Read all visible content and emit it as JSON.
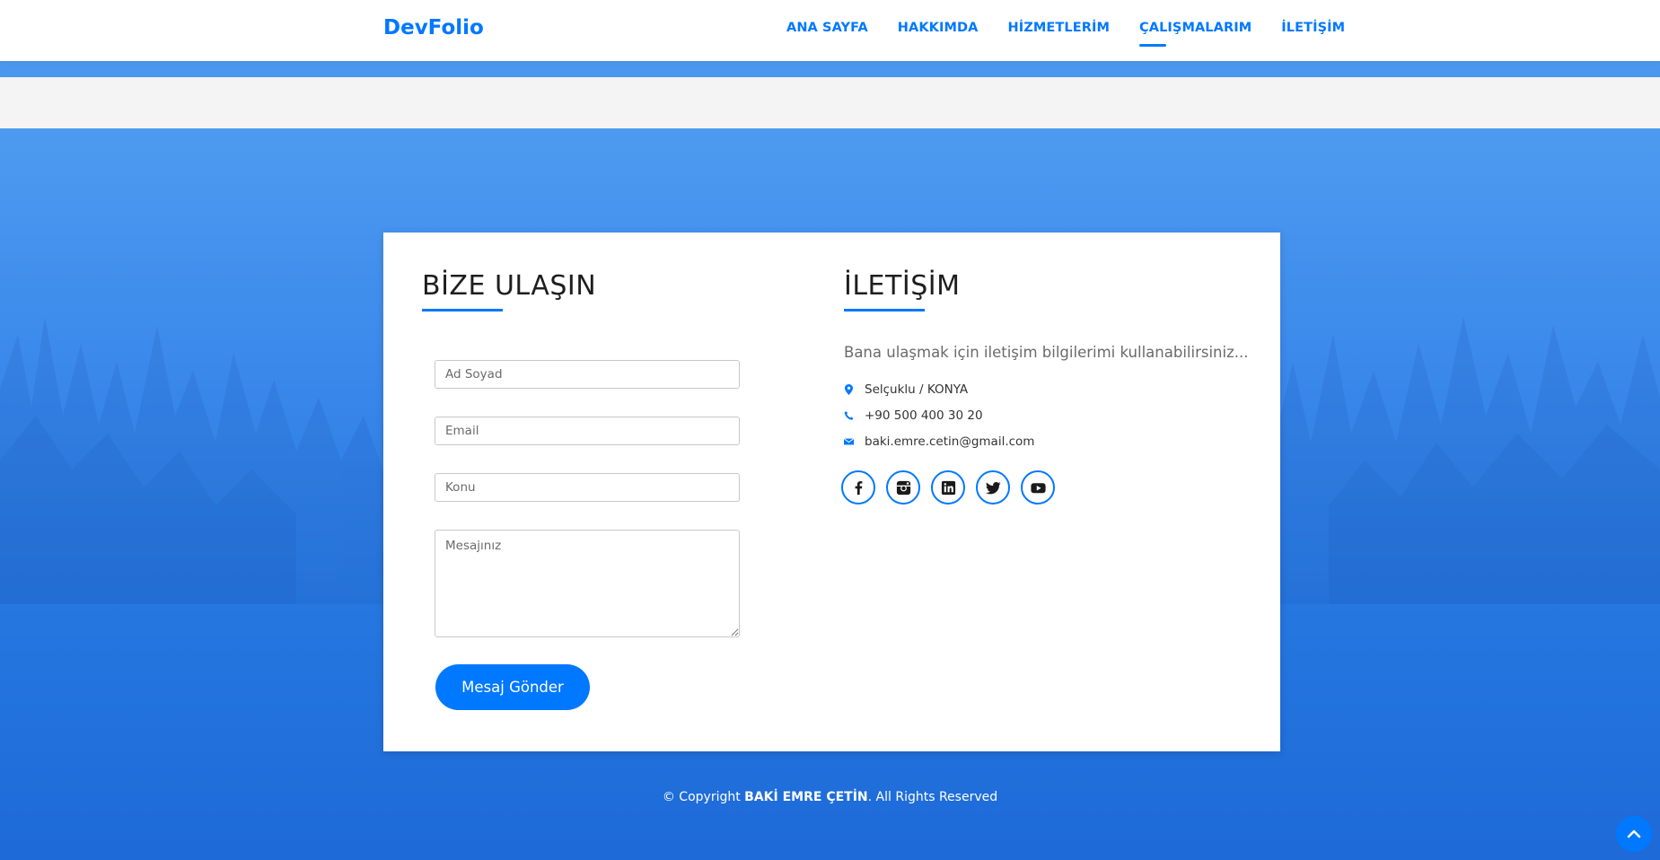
{
  "brand": "DevFolio",
  "nav": [
    {
      "label": "ANA SAYFA",
      "active": false
    },
    {
      "label": "HAKKIMDA",
      "active": false
    },
    {
      "label": "HİZMETLERİM",
      "active": false
    },
    {
      "label": "ÇALIŞMALARIM",
      "active": true
    },
    {
      "label": "İLETİŞİM",
      "active": false
    }
  ],
  "contact_form": {
    "title": "BİZE ULAŞIN",
    "name_placeholder": "Ad Soyad",
    "email_placeholder": "Email",
    "subject_placeholder": "Konu",
    "message_placeholder": "Mesajınız",
    "submit_label": "Mesaj Gönder"
  },
  "contact_info": {
    "title": "İLETİŞİM",
    "intro": "Bana ulaşmak için iletişim bilgilerimi kullanabilirsiniz...",
    "location": "Selçuklu / KONYA",
    "phone": "+90 500 400 30 20",
    "email": "baki.emre.cetin@gmail.com",
    "location_icon": "map-marker-icon",
    "phone_icon": "phone-icon",
    "email_icon": "envelope-icon"
  },
  "socials": [
    "facebook-icon",
    "instagram-icon",
    "linkedin-icon",
    "twitter-icon",
    "youtube-icon"
  ],
  "footer": {
    "prefix": "© Copyright ",
    "owner": "BAKİ EMRE ÇETİN",
    "suffix": ". All Rights Reserved"
  },
  "colors": {
    "accent": "#0078ff",
    "hero_top": "#4d9bf0",
    "hero_bottom": "#1d6ad8",
    "text_dark": "#1e1e1e"
  }
}
